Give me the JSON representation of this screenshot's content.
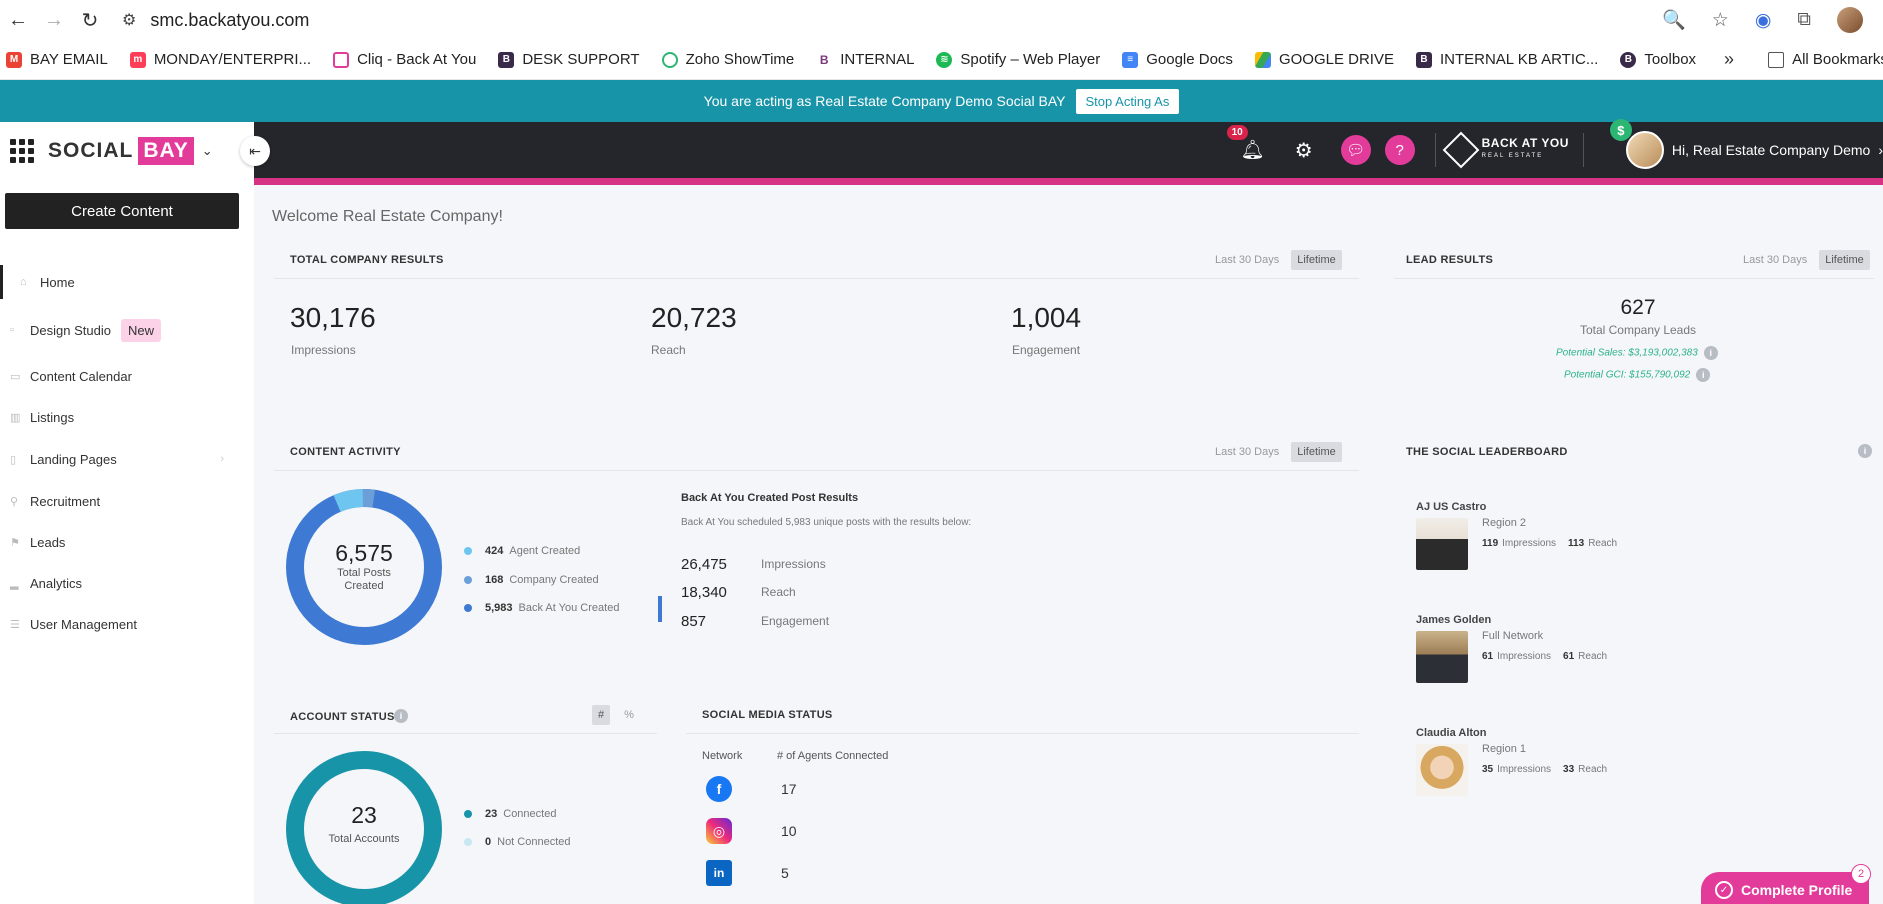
{
  "browser": {
    "url": "smc.backatyou.com",
    "bookmarks": [
      {
        "label": "BAY EMAIL",
        "color": "#ea4335",
        "icon": "gmail-icon"
      },
      {
        "label": "MONDAY/ENTERPRI...",
        "color": "#ff3d57",
        "icon": "monday-icon"
      },
      {
        "label": "Cliq - Back At You",
        "color": "#e33b9a",
        "icon": "cliq-icon"
      },
      {
        "label": "DESK SUPPORT",
        "color": "#3a2a4a",
        "icon": "desk-icon"
      },
      {
        "label": "Zoho ShowTime",
        "color": "#2bb673",
        "icon": "zoho-icon"
      },
      {
        "label": "INTERNAL",
        "color": "#7a3a7a",
        "icon": "internal-icon"
      },
      {
        "label": "Spotify – Web Player",
        "color": "#1db954",
        "icon": "spotify-icon"
      },
      {
        "label": "Google Docs",
        "color": "#4285f4",
        "icon": "docs-icon"
      },
      {
        "label": "GOOGLE  DRIVE",
        "color": "#fbbc04",
        "icon": "drive-icon"
      },
      {
        "label": "INTERNAL KB ARTIC...",
        "color": "#3a2a4a",
        "icon": "kb-icon"
      },
      {
        "label": "Toolbox",
        "color": "#3a2a4a",
        "icon": "toolbox-icon"
      }
    ],
    "all_bookmarks": "All Bookmarks"
  },
  "banner": {
    "text": "You are acting as Real Estate Company Demo Social BAY",
    "button": "Stop Acting As"
  },
  "header": {
    "logo_social": "SOCIAL",
    "logo_bay": "BAY",
    "notifications": "10",
    "partner_logo_top": "BACK AT YOU",
    "partner_logo_bottom": "REAL ESTATE",
    "user_greeting": "Hi, Real Estate Company Demo"
  },
  "sidebar": {
    "create": "Create Content",
    "items": [
      {
        "label": "Home"
      },
      {
        "label": "Design Studio",
        "badge": "New"
      },
      {
        "label": "Content Calendar"
      },
      {
        "label": "Listings"
      },
      {
        "label": "Landing Pages"
      },
      {
        "label": "Recruitment"
      },
      {
        "label": "Leads"
      },
      {
        "label": "Analytics"
      },
      {
        "label": "User Management"
      }
    ]
  },
  "main": {
    "welcome": "Welcome Real Estate Company!",
    "toggle_30": "Last 30 Days",
    "toggle_life": "Lifetime",
    "total_results": {
      "title": "TOTAL COMPANY RESULTS",
      "kpis": [
        {
          "value": "30,176",
          "label": "Impressions"
        },
        {
          "value": "20,723",
          "label": "Reach"
        },
        {
          "value": "1,004",
          "label": "Engagement"
        }
      ]
    },
    "lead_results": {
      "title": "LEAD RESULTS",
      "value": "627",
      "label": "Total Company Leads",
      "potential_sales": "Potential Sales: $3,193,002,383",
      "potential_gci": "Potential GCI: $155,790,092"
    },
    "content_activity": {
      "title": "CONTENT ACTIVITY",
      "total": "6,575",
      "total_label_1": "Total Posts",
      "total_label_2": "Created",
      "legend": [
        {
          "value": "424",
          "label": "Agent Created",
          "color": "#6ec6f0"
        },
        {
          "value": "168",
          "label": "Company Created",
          "color": "#6b9fd8"
        },
        {
          "value": "5,983",
          "label": "Back At You Created",
          "color": "#3e7ad3"
        }
      ],
      "bay_title": "Back At You Created Post Results",
      "bay_sub": "Back At You scheduled 5,983 unique posts with the results below:",
      "bay_stats": [
        {
          "value": "26,475",
          "label": "Impressions"
        },
        {
          "value": "18,340",
          "label": "Reach"
        },
        {
          "value": "857",
          "label": "Engagement"
        }
      ]
    },
    "leaderboard": {
      "title": "THE SOCIAL LEADERBOARD",
      "impressions_label": "Impressions",
      "reach_label": "Reach",
      "entries": [
        {
          "name": "AJ US Castro",
          "region": "Region 2",
          "impressions": "119",
          "reach": "113"
        },
        {
          "name": "James Golden",
          "region": "Full Network",
          "impressions": "61",
          "reach": "61"
        },
        {
          "name": "Claudia Alton",
          "region": "Region 1",
          "impressions": "35",
          "reach": "33"
        }
      ]
    },
    "account_status": {
      "title": "ACCOUNT STATUS",
      "toggle_hash": "#",
      "toggle_pct": "%",
      "total": "23",
      "total_label": "Total Accounts",
      "legend": [
        {
          "value": "23",
          "label": "Connected",
          "color": "#1894a8"
        },
        {
          "value": "0",
          "label": "Not Connected",
          "color": "#c7e8f0"
        }
      ]
    },
    "social_status": {
      "title": "SOCIAL MEDIA STATUS",
      "col_network": "Network",
      "col_agents": "# of Agents Connected",
      "rows": [
        {
          "network": "facebook-icon",
          "count": "17",
          "color": "#1877f2",
          "glyph": "f"
        },
        {
          "network": "instagram-icon",
          "count": "10",
          "color": "#d6249f",
          "glyph": "◎"
        },
        {
          "network": "linkedin-icon",
          "count": "5",
          "color": "#0a66c2",
          "glyph": "in"
        }
      ]
    },
    "complete_profile": "Complete Profile",
    "complete_profile_badge": "2"
  }
}
